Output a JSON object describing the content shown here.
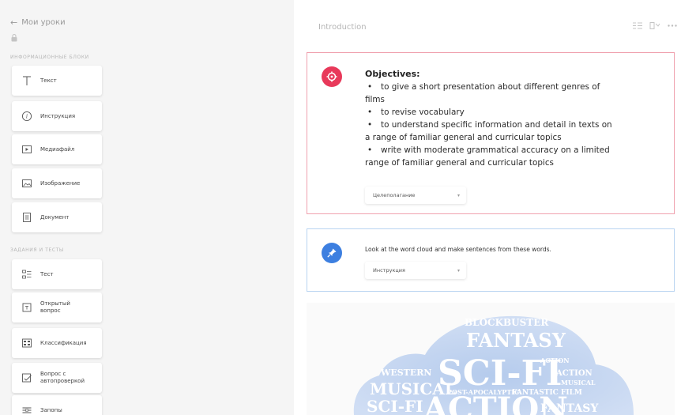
{
  "sidebar": {
    "back_label": "Мои уроки",
    "section_info_label": "информационные блоки",
    "section_tasks_label": "задания и тесты",
    "info_blocks": [
      {
        "label": "Текст",
        "icon": "text-icon"
      },
      {
        "label": "Инструкция",
        "icon": "info-icon"
      },
      {
        "label": "Медиафайл",
        "icon": "play-icon"
      },
      {
        "label": "Изображение",
        "icon": "image-icon"
      },
      {
        "label": "Документ",
        "icon": "document-icon"
      }
    ],
    "task_blocks": [
      {
        "label": "Тест",
        "icon": "test-icon"
      },
      {
        "label_line1": "Открытый",
        "label_line2": "вопрос",
        "icon": "open-question-icon"
      },
      {
        "label": "Классификация",
        "icon": "classification-icon"
      },
      {
        "label_line1": "Вопрос с",
        "label_line2": "автопроверкой",
        "icon": "auto-check-icon"
      },
      {
        "label": "Запопы",
        "icon": "fill-gaps-icon"
      }
    ]
  },
  "main": {
    "title": "Introduction",
    "objectives": {
      "title": "Objectives:",
      "items": [
        {
          "line1": "to give a short presentation about different genres of",
          "line2": "films"
        },
        {
          "line1": "to revise vocabulary",
          "line2": ""
        },
        {
          "line1": "to understand specific information and detail in texts on",
          "line2": "a range of familiar general and curricular topics"
        },
        {
          "line1": "write with moderate grammatical accuracy on a limited",
          "line2": "range of familiar general and curricular topics"
        }
      ],
      "dropdown_value": "Целеполагание",
      "accent": "#e8395a"
    },
    "instruction": {
      "text": "Look at the word cloud and make sentences from these  words.",
      "dropdown_value": "Инструкция",
      "accent": "#3d7fe0"
    },
    "word_cloud": {
      "words": {
        "blockbuster": "BLOCKBUSTER",
        "fantasy": "FANTASY",
        "scifi": "SCI-FI",
        "western": "WESTERN",
        "musical": "MUSICAL",
        "post_apocalyptic": "POST-APOCALYPTIC",
        "fantastic_film": "FANTASTIC FILM",
        "action": "ACTION",
        "scifi_small": "SCI-FI",
        "action_big": "ACTION",
        "fantasy_small": "FANTASY",
        "action_small": "ACTION",
        "musical_small": "MUSICAL"
      }
    }
  }
}
